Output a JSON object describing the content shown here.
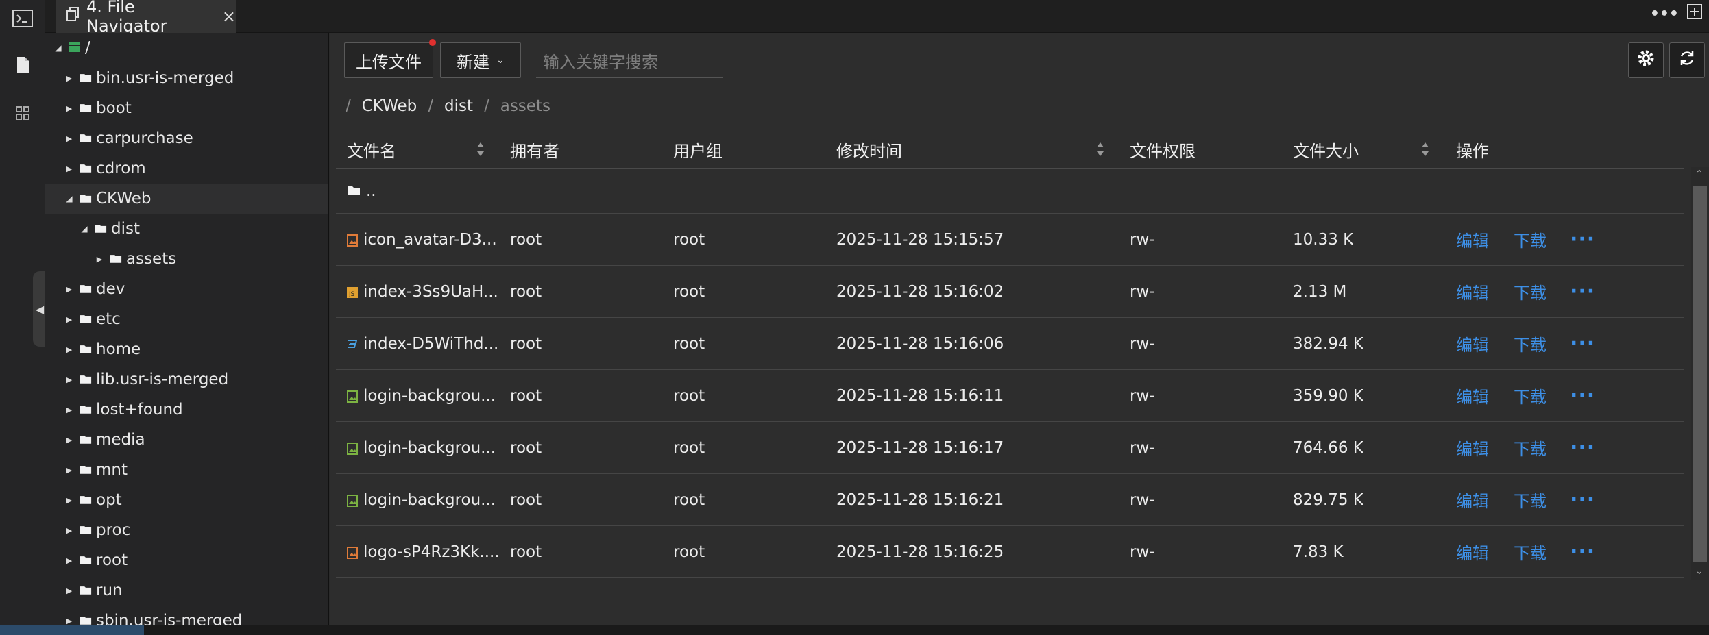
{
  "tab": {
    "title": "4. File Navigator",
    "close": "×"
  },
  "tree": {
    "root_label": "/",
    "items": [
      {
        "label": "bin.usr-is-merged"
      },
      {
        "label": "boot"
      },
      {
        "label": "carpurchase"
      },
      {
        "label": "cdrom"
      },
      {
        "label": "CKWeb"
      },
      {
        "label": "dist"
      },
      {
        "label": "assets"
      },
      {
        "label": "dev"
      },
      {
        "label": "etc"
      },
      {
        "label": "home"
      },
      {
        "label": "lib.usr-is-merged"
      },
      {
        "label": "lost+found"
      },
      {
        "label": "media"
      },
      {
        "label": "mnt"
      },
      {
        "label": "opt"
      },
      {
        "label": "proc"
      },
      {
        "label": "root"
      },
      {
        "label": "run"
      },
      {
        "label": "sbin.usr-is-merged"
      }
    ]
  },
  "toolbar": {
    "upload_label": "上传文件",
    "new_label": "新建",
    "search_placeholder": "输入关键字搜索"
  },
  "breadcrumb": {
    "sep": "/",
    "items": [
      "CKWeb",
      "dist",
      "assets"
    ]
  },
  "table": {
    "headers": {
      "name": "文件名",
      "owner": "拥有者",
      "group": "用户组",
      "mtime": "修改时间",
      "perm": "文件权限",
      "size": "文件大小",
      "actions": "操作"
    },
    "parent_label": "..",
    "rows": [
      {
        "name": "icon_avatar-D3...",
        "owner": "root",
        "group": "root",
        "mtime": "2025-11-28 15:15:57",
        "perm": "rw-",
        "size": "10.33 K",
        "icon": "image-file-icon"
      },
      {
        "name": "index-3Ss9UaH...",
        "owner": "root",
        "group": "root",
        "mtime": "2025-11-28 15:16:02",
        "perm": "rw-",
        "size": "2.13 M",
        "icon": "js-file-icon"
      },
      {
        "name": "index-D5WiThd...",
        "owner": "root",
        "group": "root",
        "mtime": "2025-11-28 15:16:06",
        "perm": "rw-",
        "size": "382.94 K",
        "icon": "css-file-icon"
      },
      {
        "name": "login-backgrou...",
        "owner": "root",
        "group": "root",
        "mtime": "2025-11-28 15:16:11",
        "perm": "rw-",
        "size": "359.90 K",
        "icon": "image-file-icon"
      },
      {
        "name": "login-backgrou...",
        "owner": "root",
        "group": "root",
        "mtime": "2025-11-28 15:16:17",
        "perm": "rw-",
        "size": "764.66 K",
        "icon": "image-file-icon"
      },
      {
        "name": "login-backgrou...",
        "owner": "root",
        "group": "root",
        "mtime": "2025-11-28 15:16:21",
        "perm": "rw-",
        "size": "829.75 K",
        "icon": "image-file-icon"
      },
      {
        "name": "logo-sP4Rz3Kk....",
        "owner": "root",
        "group": "root",
        "mtime": "2025-11-28 15:16:25",
        "perm": "rw-",
        "size": "7.83 K",
        "icon": "image-file-icon"
      }
    ],
    "edit_label": "编辑",
    "download_label": "下载",
    "more_label": "···"
  },
  "colors": {
    "link": "#3d8fe6",
    "background": "#2d2d2d",
    "sidebar": "#252526"
  }
}
